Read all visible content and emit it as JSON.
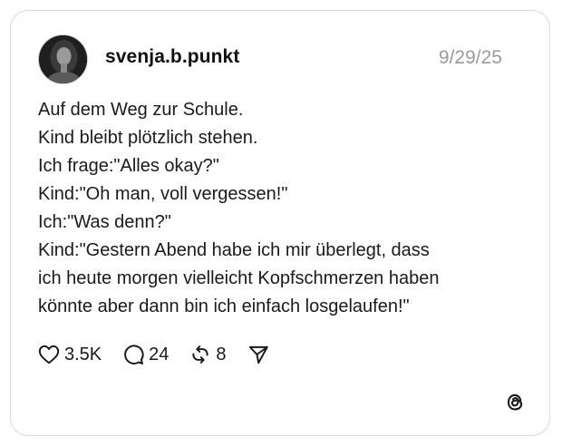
{
  "post": {
    "username": "svenja.b.punkt",
    "timestamp": "9/29/25",
    "lines": [
      "Auf dem Weg zur Schule.",
      "Kind bleibt plötzlich stehen.",
      "Ich frage:\"Alles okay?\"",
      "Kind:\"Oh man, voll vergessen!\"",
      "Ich:\"Was denn?\"",
      "Kind:\"Gestern Abend habe ich mir überlegt, dass",
      "ich heute morgen vielleicht Kopfschmerzen haben",
      "könnte aber dann bin ich einfach losgelaufen!\""
    ]
  },
  "actions": {
    "likes": "3.5K",
    "replies": "24",
    "reposts": "8"
  },
  "icons": {
    "like": "heart-icon",
    "reply": "speech-bubble-icon",
    "repost": "repost-arrows-icon",
    "share": "paper-plane-icon",
    "brand": "threads-logo-icon"
  },
  "colors": {
    "border": "#d9d9d9",
    "text": "#1a1a1a",
    "timestamp": "#9a9a9a"
  }
}
